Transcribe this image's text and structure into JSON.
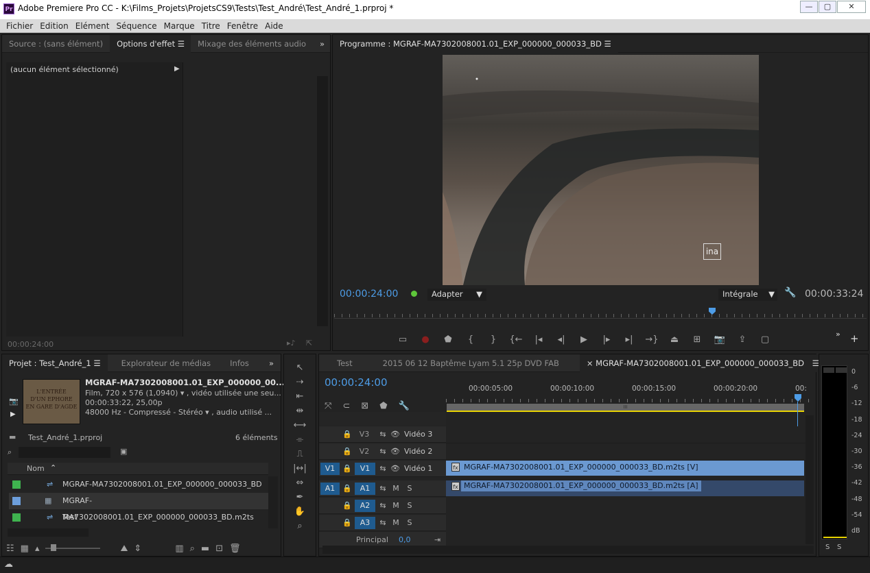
{
  "window": {
    "title": "Adobe Premiere Pro CC - K:\\Films_Projets\\ProjetsCS9\\Tests\\Test_André\\Test_André_1.prproj *",
    "app_icon": "Pr",
    "minimize": "—",
    "maximize": "▢",
    "close": "✕"
  },
  "menu": [
    "Fichier",
    "Edition",
    "Elément",
    "Séquence",
    "Marque",
    "Titre",
    "Fenêtre",
    "Aide"
  ],
  "left_top": {
    "tabs": [
      "Source : (sans élément)",
      "Options d'effet",
      "Mixage des éléments audio"
    ],
    "active_tab": "Options d'effet",
    "empty_label": "(aucun élément sélectionné)",
    "timecode": "00:00:24:00"
  },
  "program": {
    "tab_title": "Programme : MGRAF-MA7302008001.01_EXP_000000_000033_BD",
    "watermark": "ina",
    "timecode_left": "00:00:24:00",
    "zoom": "Adapter",
    "quality": "Intégrale",
    "timecode_right": "00:00:33:24",
    "playhead_fraction": 0.71
  },
  "project": {
    "tabs": [
      "Projet : Test_André_1",
      "Explorateur de médias",
      "Infos"
    ],
    "thumb_text": [
      "L'ENTRÉE",
      "D'UN EPHORE",
      "EN GARE D'AGDE"
    ],
    "clip_name": "MGRAF-MA7302008001.01_EXP_000000_00...",
    "clip_line1": "Film, 720 x 576 (1,0940) ▾ , vidéo utilisée une seu...",
    "clip_line2": "00:00:33:22, 25,00p",
    "clip_line3": "48000 Hz - Compressé - Stéréo ▾ , audio utilisé ...",
    "project_file": "Test_André_1.prproj",
    "count": "6 éléments",
    "col_header": "Nom",
    "items": [
      {
        "name": "MGRAF-MA7302008001.01_EXP_000000_000033_BD",
        "color": "#3fb34f",
        "icon": "sequence-icon"
      },
      {
        "name": "MGRAF-MA7302008001.01_EXP_000000_000033_BD.m2ts",
        "color": "#6d9fdc",
        "icon": "video-file-icon"
      },
      {
        "name": "Test",
        "color": "#3fb34f",
        "icon": "sequence-icon"
      }
    ]
  },
  "timeline": {
    "tabs": [
      "Test",
      "2015 06 12 Baptême Lyam 5.1 25p DVD FAB",
      "MGRAF-MA7302008001.01_EXP_000000_000033_BD"
    ],
    "close_glyph": "×",
    "timecode": "00:00:24:00",
    "ruler": [
      "00:00:05:00",
      "00:00:10:00",
      "00:00:15:00",
      "00:00:20:00",
      "00:"
    ],
    "ruler_handle": "III",
    "tracks": {
      "V3": {
        "label": "V3",
        "name": "Vidéo 3"
      },
      "V2": {
        "label": "V2",
        "name": "Vidéo 2"
      },
      "V1": {
        "label": "V1",
        "name": "Vidéo 1",
        "source": "V1"
      },
      "A1": {
        "label": "A1",
        "source": "A1"
      },
      "A2": {
        "label": "A2"
      },
      "A3": {
        "label": "A3"
      },
      "master": {
        "name": "Principal",
        "value": "0,0"
      }
    },
    "mute": "M",
    "solo": "S",
    "fx": "fx",
    "clip_video": "MGRAF-MA7302008001.01_EXP_000000_000033_BD.m2ts [V]",
    "clip_audio": "MGRAF-MA7302008001.01_EXP_000000_000033_BD.m2ts [A]"
  },
  "meter": {
    "labels": [
      "0",
      "-6",
      "-12",
      "-18",
      "-24",
      "-30",
      "-36",
      "-42",
      "-48",
      "-54",
      "dB"
    ],
    "solo": [
      "S",
      "S"
    ]
  },
  "colors": {
    "accent": "#4d9ce6",
    "video_clip": "#6b99d1",
    "audio_clip": "#4f7aae",
    "playhead": "#4d9ce6",
    "work_area": "#e8d400"
  }
}
